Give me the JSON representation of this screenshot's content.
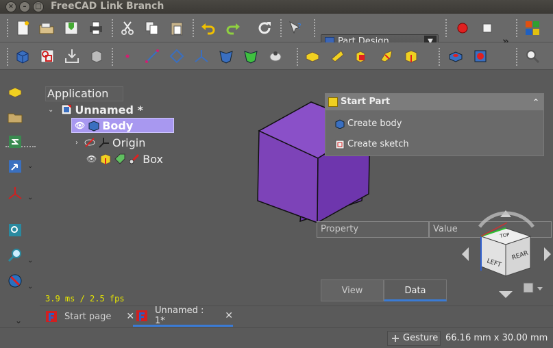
{
  "window": {
    "title": "FreeCAD Link Branch"
  },
  "toolbar": {
    "workbench": "Part Design",
    "more": "»"
  },
  "tree": {
    "header": "Application",
    "document": "Unnamed *",
    "items": [
      {
        "label": "Body"
      },
      {
        "label": "Origin"
      },
      {
        "label": "Box"
      }
    ]
  },
  "task_panel": {
    "title": "Start Part",
    "items": [
      {
        "label": "Create body"
      },
      {
        "label": "Create sketch"
      }
    ]
  },
  "property_view": {
    "columns": [
      "Property",
      "Value"
    ],
    "tabs": [
      "View",
      "Data"
    ],
    "active_tab": "Data"
  },
  "fps": "3.9 ms / 2.5 fps",
  "doc_tabs": [
    {
      "label": "Start page"
    },
    {
      "label": "Unnamed : 1*"
    }
  ],
  "status": {
    "navigation": "Gesture",
    "dimensions": "66.16 mm x 30.00 mm"
  },
  "navcube": {
    "faces": [
      "LEFT",
      "REAR",
      "TOP"
    ]
  },
  "colors": {
    "selection": "#a898f0",
    "cube": "#7d43b8",
    "accent": "#3a7bd5",
    "fps_text": "#e6e600"
  }
}
